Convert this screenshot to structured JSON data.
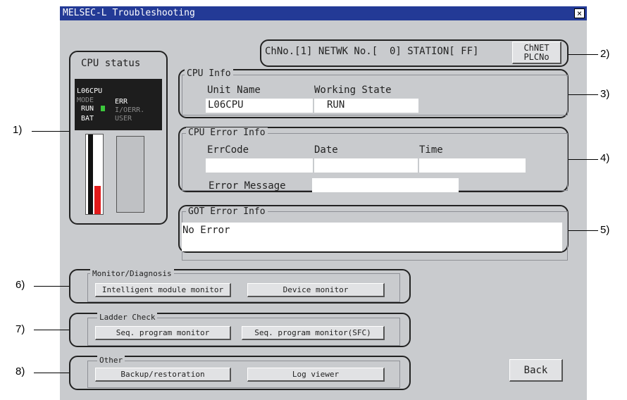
{
  "window": {
    "title": "MELSEC-L Troubleshooting",
    "close_label": "×"
  },
  "cpu_status": {
    "title": "CPU status",
    "model": "L06CPU",
    "mode": "MODE",
    "err": "ERR",
    "run": "RUN",
    "ioerr": "I/OERR.",
    "bat": "BAT",
    "user": "USER",
    "battery_level": 0.35
  },
  "station": {
    "text": "ChNo.[1] NETWK No.[  0] STATION[ FF]",
    "button_line1": "ChNET",
    "button_line2": "PLCNo"
  },
  "cpu_info": {
    "title": "CPU Info",
    "col1": "Unit Name",
    "col2": "Working State",
    "val1": "L06CPU",
    "val2": "RUN"
  },
  "cpu_error": {
    "title": "CPU Error Info",
    "col1": "ErrCode",
    "col2": "Date",
    "col3": "Time",
    "msg_label": "Error Message"
  },
  "got_error": {
    "title": "GOT Error Info",
    "message": "No Error"
  },
  "monitor": {
    "title": "Monitor/Diagnosis",
    "btn1": "Intelligent module monitor",
    "btn2": "Device monitor"
  },
  "ladder": {
    "title": "Ladder Check",
    "btn1": "Seq. program monitor",
    "btn2": "Seq. program monitor(SFC)"
  },
  "other": {
    "title": "Other",
    "btn1": "Backup/restoration",
    "btn2": "Log viewer"
  },
  "back_label": "Back",
  "callouts": [
    "1)",
    "2)",
    "3)",
    "4)",
    "5)",
    "6)",
    "7)",
    "8)"
  ],
  "colors": {
    "titlebar": "#233a96",
    "panel": "#c9cbce",
    "run_led": "#3cc83c",
    "battery": "#e21b1b"
  }
}
